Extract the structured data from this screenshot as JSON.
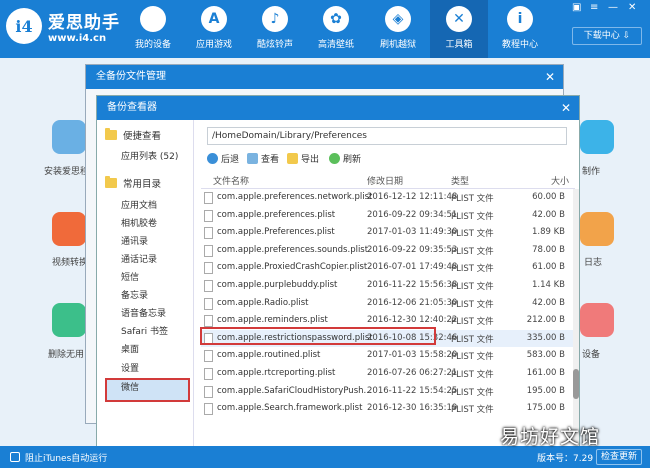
{
  "app": {
    "logo_mark": "i4",
    "name": "爱思助手",
    "url": "www.i4.cn",
    "download_label": "下载中心 ⇩",
    "window_controls": [
      "▣",
      "≡",
      "—",
      "✕"
    ]
  },
  "nav": [
    {
      "label": "我的设备",
      "icon": "apple-icon",
      "glyph": ""
    },
    {
      "label": "应用游戏",
      "icon": "app-store-icon",
      "glyph": "A"
    },
    {
      "label": "酷炫铃声",
      "icon": "bell-icon",
      "glyph": "♪"
    },
    {
      "label": "高清壁纸",
      "icon": "flower-icon",
      "glyph": "✿"
    },
    {
      "label": "刷机越狱",
      "icon": "dropbox-icon",
      "glyph": "◈"
    },
    {
      "label": "工具箱",
      "icon": "tools-icon",
      "glyph": "✕"
    },
    {
      "label": "教程中心",
      "icon": "info-icon",
      "glyph": "i"
    }
  ],
  "background": {
    "labels": [
      "安装爱思移",
      "视频转换",
      "删除无用",
      "制作",
      "日志",
      "设备"
    ]
  },
  "outer_dialog": {
    "title": "全备份文件管理"
  },
  "inner_dialog": {
    "title": "备份查看器",
    "close": "✕",
    "path": "/HomeDomain/Library/Preferences",
    "toolbar": {
      "back": "后退",
      "view": "查看",
      "export": "导出",
      "refresh": "刷新"
    },
    "sidebar": {
      "group1": "便捷查看",
      "group1_items": [
        "应用列表 (52)"
      ],
      "group2": "常用目录",
      "group2_items": [
        "应用文档",
        "相机胶卷",
        "通讯录",
        "通话记录",
        "短信",
        "备忘录",
        "语音备忘录",
        "Safari 书签",
        "桌面",
        "设置",
        "微信"
      ]
    },
    "columns": {
      "name": "文件名称",
      "date": "修改日期",
      "type": "类型",
      "size": "大小"
    },
    "rows": [
      {
        "name": "com.apple.preferences.network.plist",
        "date": "2016-12-12 12:11:48",
        "type": "PLIST 文件",
        "size": "60.00 B"
      },
      {
        "name": "com.apple.preferences.plist",
        "date": "2016-09-22 09:34:51",
        "type": "PLIST 文件",
        "size": "42.00 B"
      },
      {
        "name": "com.apple.Preferences.plist",
        "date": "2017-01-03 11:49:30",
        "type": "PLIST 文件",
        "size": "1.89 KB"
      },
      {
        "name": "com.apple.preferences.sounds.plist",
        "date": "2016-09-22 09:35:53",
        "type": "PLIST 文件",
        "size": "78.00 B"
      },
      {
        "name": "com.apple.ProxiedCrashCopier.plist",
        "date": "2016-07-01 17:49:48",
        "type": "PLIST 文件",
        "size": "61.00 B"
      },
      {
        "name": "com.apple.purplebuddy.plist",
        "date": "2016-11-22 15:56:38",
        "type": "PLIST 文件",
        "size": "1.14 KB"
      },
      {
        "name": "com.apple.Radio.plist",
        "date": "2016-12-06 21:05:30",
        "type": "PLIST 文件",
        "size": "42.00 B"
      },
      {
        "name": "com.apple.reminders.plist",
        "date": "2016-12-30 12:40:22",
        "type": "PLIST 文件",
        "size": "212.00 B"
      },
      {
        "name": "com.apple.restrictionspassword.plist",
        "date": "2016-10-08 15:32:46",
        "type": "PLIST 文件",
        "size": "335.00 B"
      },
      {
        "name": "com.apple.routined.plist",
        "date": "2017-01-03 15:58:20",
        "type": "PLIST 文件",
        "size": "583.00 B"
      },
      {
        "name": "com.apple.rtcreporting.plist",
        "date": "2016-07-26 06:27:21",
        "type": "PLIST 文件",
        "size": "161.00 B"
      },
      {
        "name": "com.apple.SafariCloudHistoryPush...",
        "date": "2016-11-22 15:54:25",
        "type": "PLIST 文件",
        "size": "195.00 B"
      },
      {
        "name": "com.apple.Search.framework.plist",
        "date": "2016-12-30 16:35:19",
        "type": "PLIST 文件",
        "size": "175.00 B"
      }
    ]
  },
  "status": {
    "itunes_label": "阻止iTunes自动运行",
    "version": "版本号：7.29",
    "update": "检查更新"
  },
  "watermark": "易坊好文馆",
  "colors": {
    "accent": "#1a7fd4",
    "highlight": "#d23a3a"
  }
}
